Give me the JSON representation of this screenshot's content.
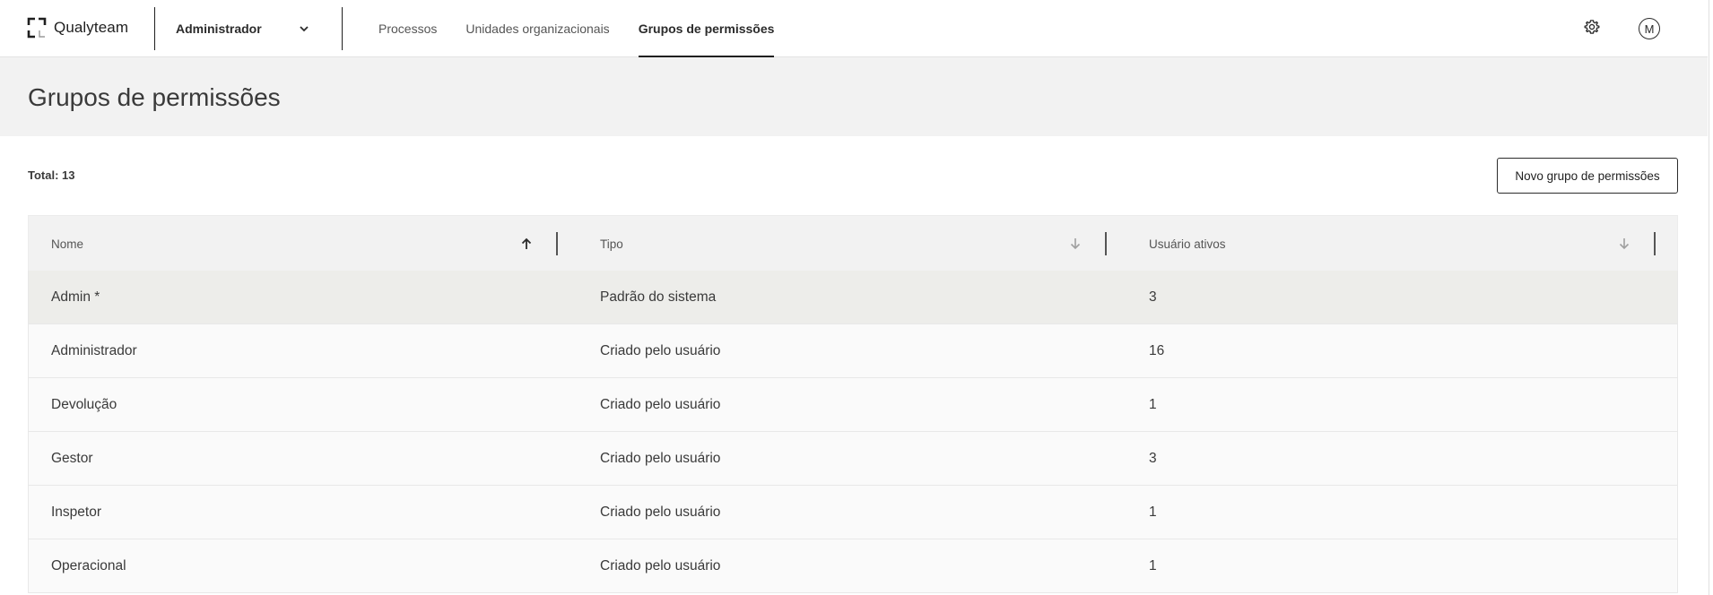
{
  "brand": {
    "name": "Qualyteam"
  },
  "org_selector": {
    "value": "Administrador"
  },
  "nav": {
    "items": [
      {
        "label": "Processos",
        "active": false
      },
      {
        "label": "Unidades organizacionais",
        "active": false
      },
      {
        "label": "Grupos de permissões",
        "active": true
      }
    ]
  },
  "header_icons": {
    "settings": "gear-icon",
    "avatar_initial": "M"
  },
  "page": {
    "title": "Grupos de permissões"
  },
  "summary": {
    "total_label": "Total: 13"
  },
  "actions": {
    "new_group_label": "Novo grupo de permissões"
  },
  "table": {
    "columns": [
      {
        "label": "Nome",
        "sort": "ascending"
      },
      {
        "label": "Tipo",
        "sort": "none"
      },
      {
        "label": "Usuário ativos",
        "sort": "none"
      }
    ],
    "rows": [
      {
        "name": "Admin *",
        "type": "Padrão do sistema",
        "active_users": "3"
      },
      {
        "name": "Administrador",
        "type": "Criado pelo usuário",
        "active_users": "16"
      },
      {
        "name": "Devolução",
        "type": "Criado pelo usuário",
        "active_users": "1"
      },
      {
        "name": "Gestor",
        "type": "Criado pelo usuário",
        "active_users": "3"
      },
      {
        "name": "Inspetor",
        "type": "Criado pelo usuário",
        "active_users": "1"
      },
      {
        "name": "Operacional",
        "type": "Criado pelo usuário",
        "active_users": "1"
      }
    ]
  },
  "colors": {
    "accent": "#1f1f1f",
    "header_bg": "#f2f2f2",
    "row_hover": "#ededea"
  }
}
